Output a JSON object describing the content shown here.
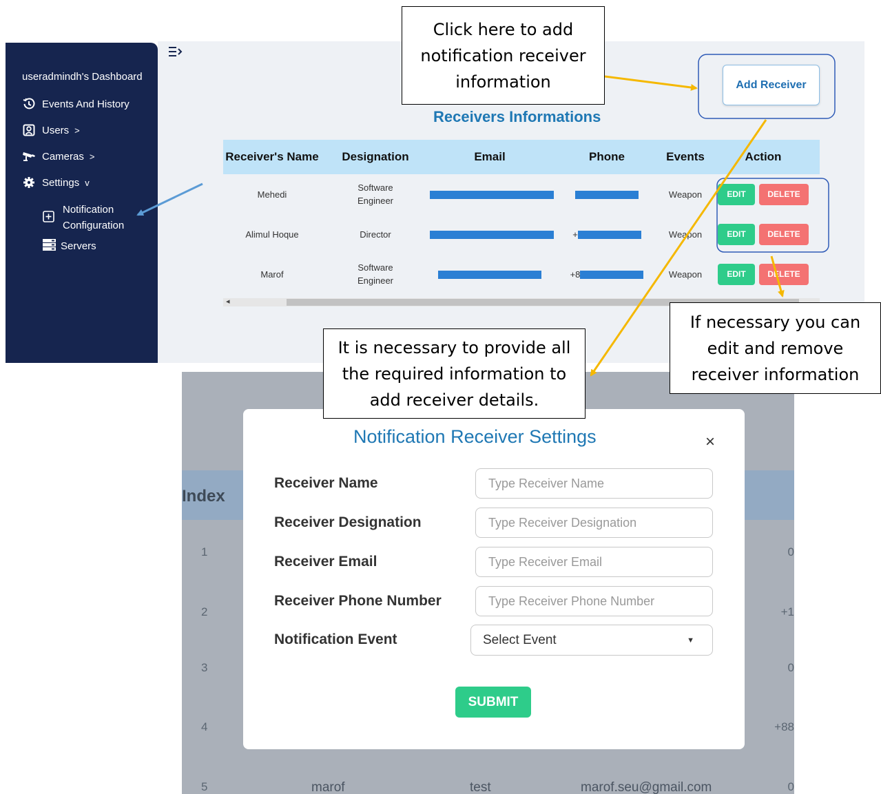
{
  "sidebar": {
    "dashboard_title": "useradmindh's Dashboard",
    "items": [
      {
        "label": "Events And History",
        "icon": "history-icon"
      },
      {
        "label": "Users",
        "icon": "user-icon",
        "chevron": ">"
      },
      {
        "label": "Cameras",
        "icon": "camera-icon",
        "chevron": ">"
      },
      {
        "label": "Settings",
        "icon": "gear-icon",
        "chevron": "v"
      }
    ],
    "sub_items": [
      {
        "label_line1": "Notification",
        "label_line2": "Configuration",
        "icon": "plus-square-icon"
      },
      {
        "label": "Servers",
        "icon": "server-icon"
      }
    ]
  },
  "main": {
    "add_receiver_label": "Add Receiver",
    "heading": "Receivers Informations",
    "table": {
      "headers": [
        "Receiver's Name",
        "Designation",
        "Email",
        "Phone",
        "Events",
        "Action"
      ],
      "rows": [
        {
          "name": "Mehedi",
          "designation_line1": "Software",
          "designation_line2": "Engineer",
          "phone_prefix": "",
          "event": "Weapon"
        },
        {
          "name": "Alimul Hoque",
          "designation_line1": "Director",
          "designation_line2": "",
          "phone_prefix": "+",
          "event": "Weapon"
        },
        {
          "name": "Marof",
          "designation_line1": "Software",
          "designation_line2": "Engineer",
          "phone_prefix": "+8",
          "event": "Weapon"
        }
      ],
      "edit_label": "EDIT",
      "delete_label": "DELETE"
    }
  },
  "modal": {
    "title": "Notification Receiver Settings",
    "close_glyph": "×",
    "fields": [
      {
        "label": "Receiver Name",
        "placeholder": "Type  Receiver Name"
      },
      {
        "label": "Receiver Designation",
        "placeholder": "Type  Receiver Designation"
      },
      {
        "label": "Receiver Email",
        "placeholder": "Type Receiver Email"
      },
      {
        "label": "Receiver Phone Number",
        "placeholder": "Type  Receiver Phone Number"
      }
    ],
    "event_label": "Notification Event",
    "event_select": "Select Event",
    "submit_label": "SUBMIT"
  },
  "background_table": {
    "index_header": "Index",
    "indices": [
      "1",
      "2",
      "3",
      "4",
      "5"
    ],
    "right_values": [
      "0",
      "+1",
      "0",
      "+88",
      "0"
    ],
    "row5": {
      "name": "marof",
      "designation": "test",
      "email": "marof.seu@gmail.com"
    }
  },
  "callouts": {
    "add": [
      "Click here to add",
      "notification receiver",
      "information"
    ],
    "required": [
      "It is necessary to provide all",
      "the required information to",
      "add receiver details."
    ],
    "edit": [
      "If necessary you can",
      "edit and remove",
      "receiver information"
    ]
  },
  "colors": {
    "sidebar_bg": "#16254f",
    "accent_blue": "#1f78b4",
    "edit_green": "#2ecc8a",
    "delete_red": "#f47272",
    "arrow_yellow": "#f5b800",
    "arrow_blue": "#5b9bd5"
  }
}
